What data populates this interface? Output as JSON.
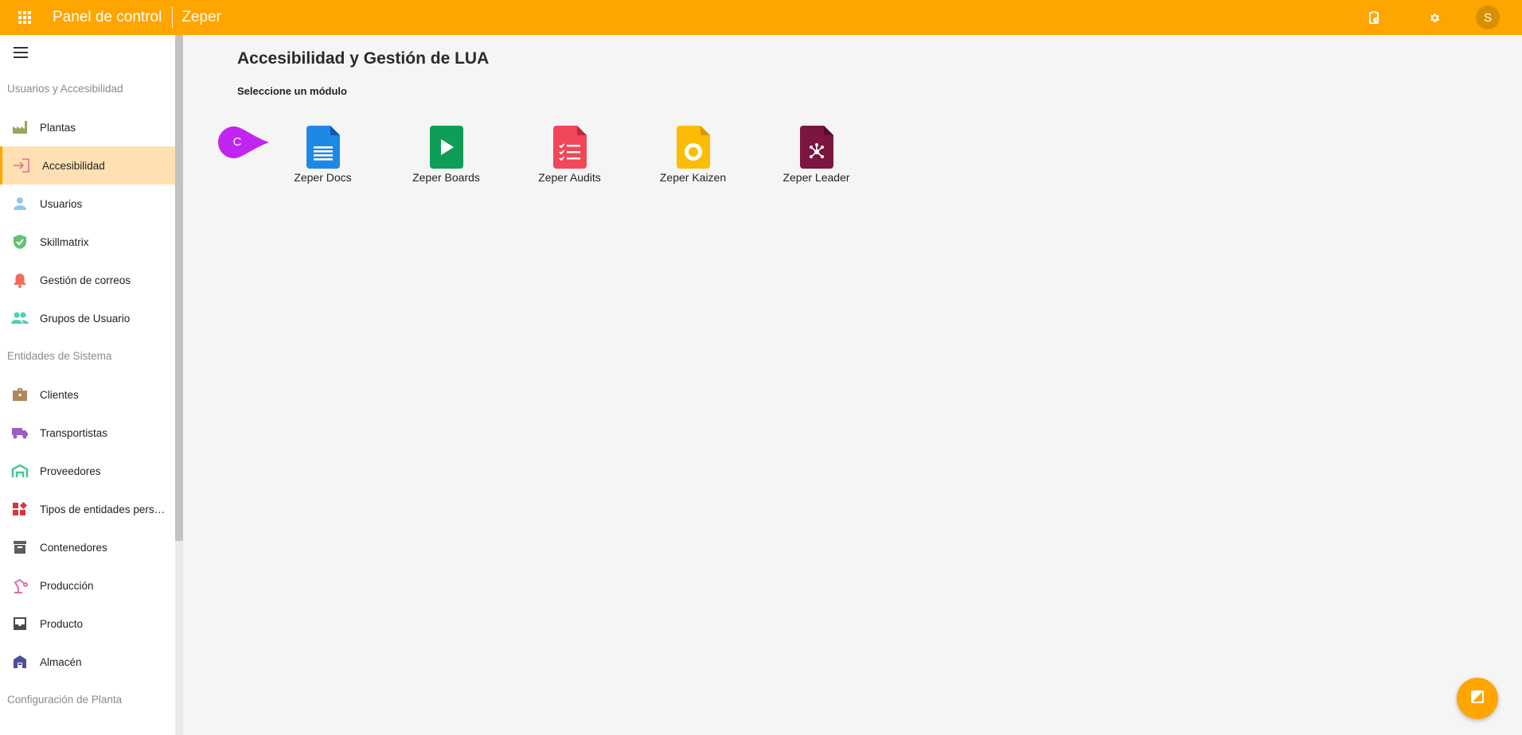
{
  "topbar": {
    "app_title": "Panel de control",
    "brand": "Zeper",
    "avatar_initial": "S",
    "icons": [
      "apps-grid-icon",
      "clipboard-clock-icon",
      "gear-icon"
    ]
  },
  "sidebar": {
    "sections": [
      {
        "title": "Usuarios y Accesibilidad",
        "items": [
          {
            "label": "Plantas",
            "icon": "factory-icon",
            "color": "#9ea35a"
          },
          {
            "label": "Accesibilidad",
            "icon": "login-arrow-icon",
            "color": "#e46b9a",
            "active": true
          },
          {
            "label": "Usuarios",
            "icon": "person-icon",
            "color": "#8ec9ec"
          },
          {
            "label": "Skillmatrix",
            "icon": "shield-check-icon",
            "color": "#62c370"
          },
          {
            "label": "Gestión de correos",
            "icon": "bell-icon",
            "color": "#f26c5b"
          },
          {
            "label": "Grupos de Usuario",
            "icon": "people-icon",
            "color": "#4cd0b7"
          }
        ]
      },
      {
        "title": "Entidades de Sistema",
        "items": [
          {
            "label": "Clientes",
            "icon": "briefcase-icon",
            "color": "#b0885d"
          },
          {
            "label": "Transportistas",
            "icon": "truck-icon",
            "color": "#9a5ec7"
          },
          {
            "label": "Proveedores",
            "icon": "warehouse-icon",
            "color": "#3ec98f"
          },
          {
            "label": "Tipos de entidades personalizadas",
            "icon": "widgets-icon",
            "color": "#d9343f"
          },
          {
            "label": "Contenedores",
            "icon": "archive-box-icon",
            "color": "#5d5d5d"
          },
          {
            "label": "Producción",
            "icon": "robot-arm-icon",
            "color": "#e26cab"
          },
          {
            "label": "Producto",
            "icon": "inbox-tray-icon",
            "color": "#4a4a4a"
          },
          {
            "label": "Almacén",
            "icon": "warehouse-building-icon",
            "color": "#4b4e9e"
          }
        ]
      },
      {
        "title": "Configuración de Planta",
        "items": []
      }
    ]
  },
  "main": {
    "title": "Accesibilidad y Gestión de LUA",
    "subtitle": "Seleccione un módulo",
    "modules": [
      {
        "label": "Zeper Docs",
        "icon": "docs-file-icon",
        "color": "#1e88e5"
      },
      {
        "label": "Zeper Boards",
        "icon": "boards-play-icon",
        "color": "#0f9d58"
      },
      {
        "label": "Zeper Audits",
        "icon": "audits-checklist-icon",
        "color": "#f0485a"
      },
      {
        "label": "Zeper Kaizen",
        "icon": "kaizen-circle-icon",
        "color": "#fbbc05"
      },
      {
        "label": "Zeper Leader",
        "icon": "leader-network-icon",
        "color": "#7b1640"
      }
    ]
  },
  "marker": {
    "letter": "C",
    "color": "#c026f0"
  },
  "colors": {
    "accent": "#ffa500",
    "active_bg": "#ffe0b2"
  }
}
